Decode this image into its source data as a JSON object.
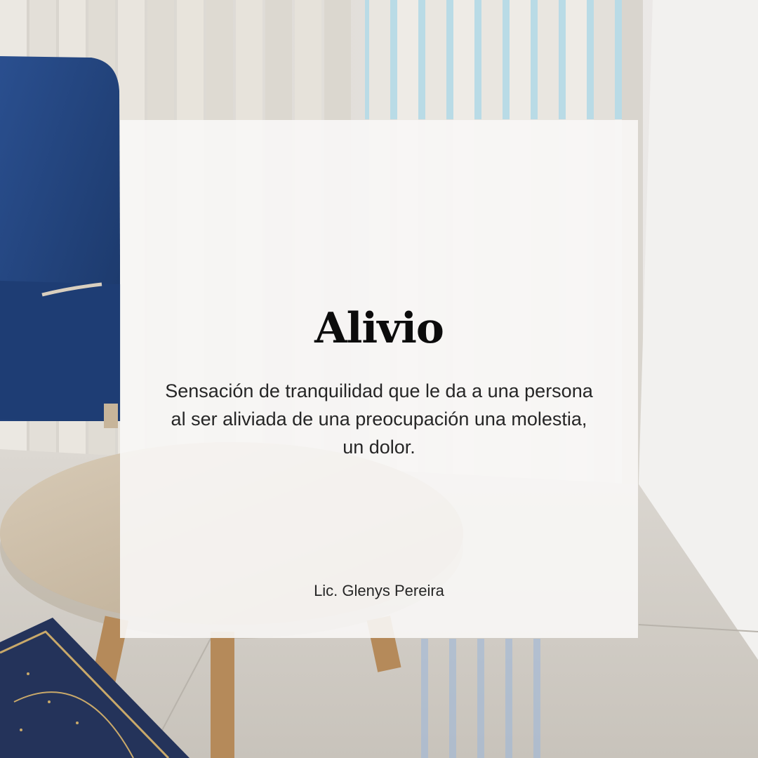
{
  "card": {
    "title": "Alivio",
    "description": "Sensación de tranquilidad que le da a una persona al ser aliviada de una preocupación una molestia, un dolor.",
    "author": "Lic. Glenys Pereira"
  },
  "colors": {
    "card_background": "#f8f7f6",
    "title_text": "#0c0c0c",
    "body_text": "#262626",
    "armchair_blue": "#1f3f7a",
    "table_wood": "#c9b9a3",
    "book_navy": "#24335a",
    "book_gold": "#c9a96a"
  }
}
